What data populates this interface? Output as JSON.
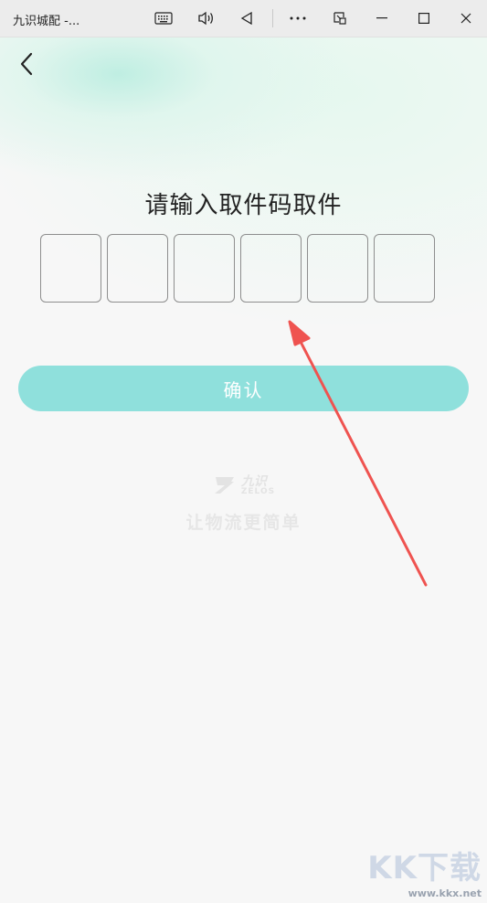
{
  "window": {
    "title": "九识城配 -...",
    "icons": [
      "keyboard-icon",
      "volume-icon",
      "back-triangle-icon",
      "more-icon",
      "picture-in-picture-icon",
      "minimize-icon",
      "maximize-icon",
      "close-icon"
    ]
  },
  "page": {
    "heading": "请输入取件码取件",
    "code_boxes": [
      "",
      "",
      "",
      "",
      "",
      ""
    ],
    "confirm_label": "确认",
    "logo_text": "九识",
    "logo_sub": "ZELOS",
    "slogan": "让物流更简单"
  },
  "watermark": {
    "brand": "KK下载",
    "url": "www.kkx.net"
  },
  "colors": {
    "accent": "#8fe0dc",
    "annotation_arrow": "#ef5350",
    "background": "#f7f7f7"
  }
}
